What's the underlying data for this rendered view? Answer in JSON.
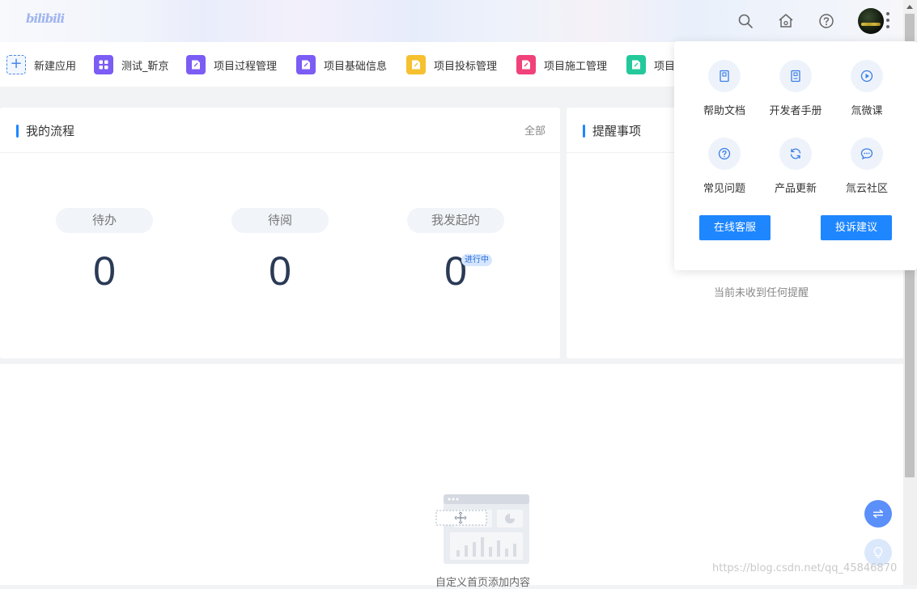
{
  "header": {
    "logo_text": "bilibili",
    "icons": [
      "search-icon",
      "home-icon",
      "help-icon",
      "avatar",
      "more-icon"
    ]
  },
  "apps": [
    {
      "label": "新建应用",
      "color": "#4a86e8",
      "icon": "plus-icon"
    },
    {
      "label": "测试_靳京",
      "color": "#7b5cf5",
      "icon": "grid-icon"
    },
    {
      "label": "项目过程管理",
      "color": "#7b5cf5",
      "icon": "form-icon"
    },
    {
      "label": "项目基础信息",
      "color": "#7b5cf5",
      "icon": "form-icon"
    },
    {
      "label": "项目投标管理",
      "color": "#f6c02e",
      "icon": "form-icon"
    },
    {
      "label": "项目施工管理",
      "color": "#f0417a",
      "icon": "form-icon"
    },
    {
      "label": "项目",
      "color": "#23c99a",
      "icon": "form-icon"
    }
  ],
  "my_process": {
    "title": "我的流程",
    "all_link": "全部",
    "stats": [
      {
        "label": "待办",
        "value": "0"
      },
      {
        "label": "待阅",
        "value": "0"
      },
      {
        "label": "我发起的",
        "value": "0",
        "badge": "进行中"
      }
    ]
  },
  "reminders": {
    "title": "提醒事项",
    "empty_text": "当前未收到任何提醒"
  },
  "custom_home": {
    "text": "自定义首页添加内容"
  },
  "help_panel": {
    "items": [
      {
        "label": "帮助文档",
        "icon": "document-icon"
      },
      {
        "label": "开发者手册",
        "icon": "manual-icon"
      },
      {
        "label": "氚微课",
        "icon": "play-icon"
      },
      {
        "label": "常见问题",
        "icon": "question-icon"
      },
      {
        "label": "产品更新",
        "icon": "refresh-icon"
      },
      {
        "label": "氚云社区",
        "icon": "chat-icon"
      }
    ],
    "online_service": "在线客服",
    "feedback": "投诉建议",
    "accent": "#1e86ff"
  },
  "watermark": "https://blog.csdn.net/qq_45846870"
}
